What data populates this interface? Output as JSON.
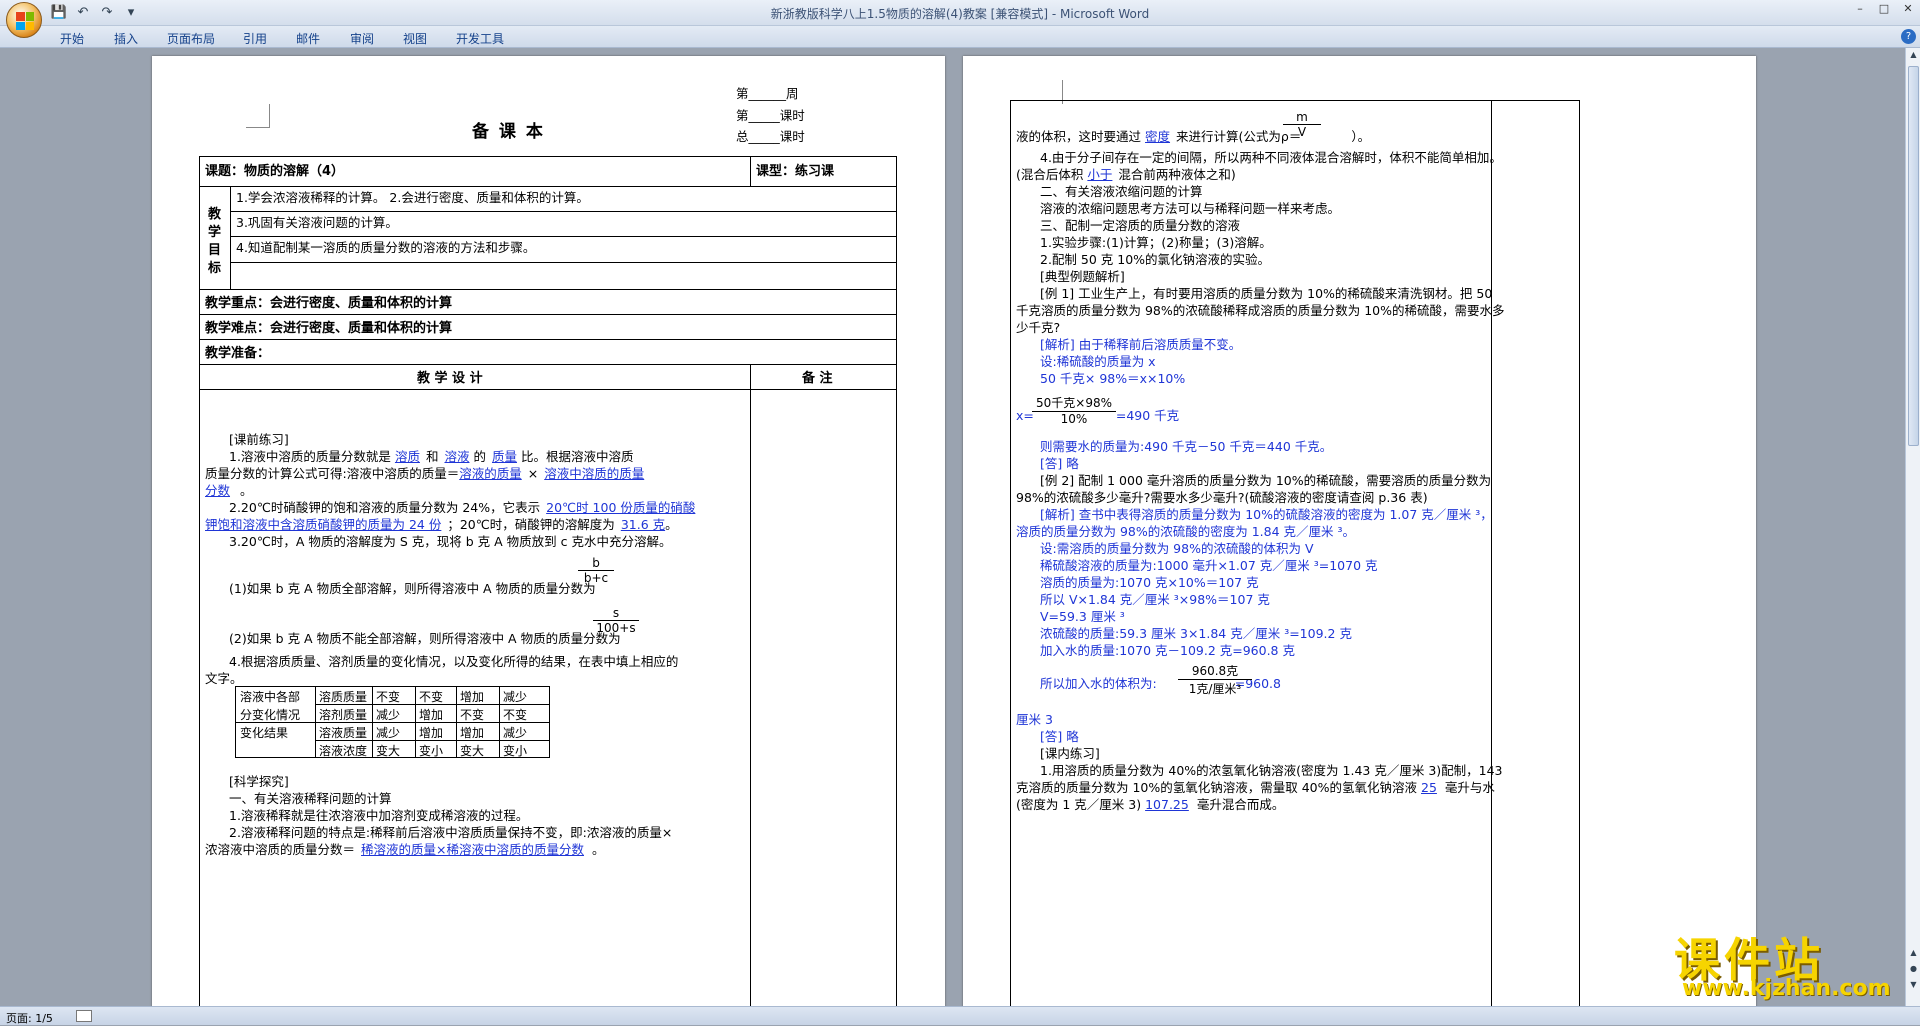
{
  "window": {
    "title": "新浙教版科学八上1.5物质的溶解(4)教案 [兼容模式] - Microsoft Word",
    "controls": [
      "–",
      "□",
      "✕"
    ]
  },
  "ribbon": {
    "tabs": [
      "开始",
      "插入",
      "页面布局",
      "引用",
      "邮件",
      "审阅",
      "视图",
      "开发工具"
    ],
    "help": "?"
  },
  "qat": {
    "save": "💾",
    "undo": "↶",
    "redo": "↷",
    "more": "▾"
  },
  "status": {
    "page": "页面: 1/5"
  },
  "brand": {
    "line1": "课件站",
    "line2": "www.kjzhan.com"
  },
  "page1": {
    "week": "第______周",
    "period": "第_____课时",
    "total": "总_____课时",
    "heading": "备 课 本",
    "topic": "课题：物质的溶解（4）",
    "type": "课型：练习课",
    "goal_label": "教学目标",
    "goals": [
      "1.学会浓溶液稀释的计算。 2.会进行密度、质量和体积的计算。",
      "3.巩固有关溶液问题的计算。",
      "4.知道配制某一溶质的质量分数的溶液的方法和步骤。",
      ""
    ],
    "key": "教学重点：会进行密度、质量和体积的计算",
    "diff": "教学难点：会进行密度、质量和体积的计算",
    "prep": "教学准备：",
    "design": "教 学 设 计",
    "note": "备  注",
    "pre": "[课前练习]",
    "q1a": "1.溶液中溶质的质量分数就是",
    "q1b": "溶质",
    "q1c": "和",
    "q1d": "溶液",
    "q1e": "的",
    "q1f": "质量",
    "q1g": "比。根据溶液中溶质",
    "q1h": "质量分数的计算公式可得:溶液中溶质的质量＝",
    "q1i": "溶液的质量",
    "q1j": "×",
    "q1k": "溶液中溶质的质量",
    "q1l": "分数",
    "q1m": "。",
    "q2a": "2.20℃时硝酸钾的饱和溶液的质量分数为 24%，它表示",
    "q2b": "20℃时 100 份质量的硝酸",
    "q2c": "钾饱和溶液中含溶质硝酸钾的质量为 24 份",
    "q2d": "；20℃时，硝酸钾的溶解度为",
    "q2e": "31.6 克",
    "q2f": "。",
    "q3": "3.20℃时，A 物质的溶解度为 S 克，现将 b 克 A 物质放到 c 克水中充分溶解。",
    "q3a": "(1)如果 b 克 A 物质全部溶解，则所得溶液中 A 物质的质量分数为",
    "q3a_num": "b",
    "q3a_den": "b+c",
    "q3b": "(2)如果 b 克 A 物质不能全部溶解，则所得溶液中 A 物质的质量分数为",
    "q3b_num": "s",
    "q3b_den": "100+s",
    "q4a": "4.根据溶质质量、溶剂质量的变化情况，以及变化所得的结果，在表中填上相应的",
    "q4b": "文字。",
    "table": {
      "left1": "溶液中各部",
      "left2": "分变化情况",
      "left3": "变化结果",
      "rows": [
        [
          "溶质质量",
          "不变",
          "不变",
          "增加",
          "减少"
        ],
        [
          "溶剂质量",
          "减少",
          "增加",
          "不变",
          "不变"
        ],
        [
          "溶液质量",
          "减少",
          "增加",
          "增加",
          "减少"
        ],
        [
          "溶液浓度",
          "变大",
          "变小",
          "变大",
          "变小"
        ]
      ]
    },
    "explore": "[科学探究]",
    "s1": "一、有关溶液稀释问题的计算",
    "s1a": "1.溶液稀释就是往浓溶液中加溶剂变成稀溶液的过程。",
    "s1b": "2.溶液稀释问题的特点是:稀释前后溶液中溶质质量保持不变，即:浓溶液的质量×",
    "s1c": "浓溶液中溶质的质量分数＝",
    "s1d": "稀溶液的质量×稀溶液中溶质的质量分数",
    "s1e": "。"
  },
  "page2": {
    "l1a": "液的体积，这时要通过",
    "l1b": "密度",
    "l1c": "来进行计算(公式为ρ＝",
    "l1m": "m",
    "l1v": "V",
    "l1d": "）。",
    "l2": "4.由于分子间存在一定的间隔，所以两种不同液体混合溶解时，体积不能简单相加。",
    "l3a": "(混合后体积",
    "l3b": "小于",
    "l3c": "混合前两种液体之和)",
    "l4": "二、有关溶液浓缩问题的计算",
    "l5": "溶液的浓缩问题思考方法可以与稀释问题一样来考虑。",
    "l6": "三、配制一定溶质的质量分数的溶液",
    "l7": "1.实验步骤:(1)计算；(2)称量；(3)溶解。",
    "l8": "2.配制 50 克 10%的氯化钠溶液的实验。",
    "l9": "[典型例题解析]",
    "l10": "[例 1]  工业生产上，有时要用溶质的质量分数为 10%的稀硫酸来清洗钢材。把 50",
    "l11": "千克溶质的质量分数为 98%的浓硫酸稀释成溶质的质量分数为 10%的稀硫酸，需要水多",
    "l12": "少千克?",
    "l13": "[解析]  由于稀释前后溶质质量不变。",
    "l14": "设:稀硫酸的质量为 x",
    "l15": "50 千克× 98%＝x×10%",
    "l16a": "x=",
    "l16n": "50千克×98%",
    "l16d": "10%",
    "l16b": "=490 千克",
    "l17": "则需要水的质量为:490 千克－50 千克＝440 千克。",
    "l18": "[答]  略",
    "l19": "[例 2]  配制 1 000 毫升溶质的质量分数为 10%的稀硫酸，需要溶质的质量分数为",
    "l20": "98%的浓硫酸多少毫升?需要水多少毫升?(硫酸溶液的密度请查阅 p.36 表)",
    "l21": "[解析]  查书中表得溶质的质量分数为 10%的硫酸溶液的密度为 1.07 克／厘米 ³，",
    "l22": "溶质的质量分数为 98%的浓硫酸的密度为 1.84 克／厘米 ³。",
    "l23": "设:需溶质的质量分数为 98%的浓硫酸的体积为 V",
    "l24": "稀硫酸溶液的质量为:1000 毫升×1.07 克／厘米 ³=1070 克",
    "l25": "溶质的质量为:1070 克×10%＝107 克",
    "l26": "所以 V×1.84 克／厘米 ³×98%＝107 克",
    "l27": "V=59.3 厘米 ³",
    "l28": "浓硫酸的质量:59.3 厘米 3×1.84 克／厘米 ³=109.2 克",
    "l29": "加入水的质量:1070 克－109.2 克=960.8 克",
    "l30a": "所以加入水的体积为:",
    "l30n": "960.8克",
    "l30d": "1克/厘米³",
    "l30b": "=960.8",
    "l31": "厘米 3",
    "l32": "[答]  略",
    "l33": "[课内练习]",
    "l34": "1.用溶质的质量分数为 40%的浓氢氧化钠溶液(密度为 1.43 克／厘米 3)配制，143",
    "l35a": "克溶质的质量分数为 10%的氢氧化钠溶液，需量取 40%的氢氧化钠溶液",
    "l35b": "25",
    "l35c": "毫升与水",
    "l36a": "(密度为 1 克／厘米 3)",
    "l36b": "107.25",
    "l36c": "毫升混合而成。"
  }
}
